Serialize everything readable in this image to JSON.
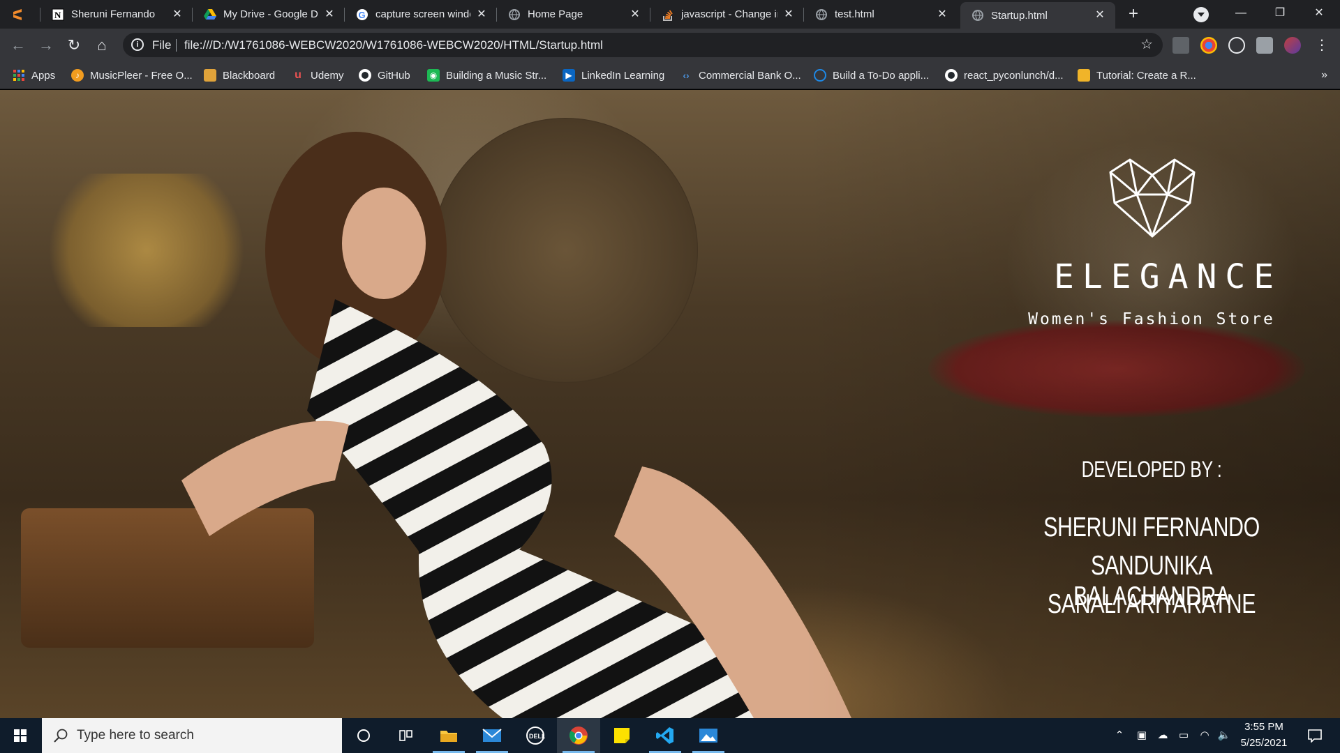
{
  "browser": {
    "tabs": [
      {
        "title": "",
        "icon": "sublime-icon",
        "active": false
      },
      {
        "title": "Sheruni Fernando",
        "icon": "notion-icon",
        "active": false
      },
      {
        "title": "My Drive - Google D",
        "icon": "google-drive-icon",
        "active": false
      },
      {
        "title": "capture screen windo",
        "icon": "google-icon",
        "active": false
      },
      {
        "title": "Home Page",
        "icon": "globe-icon",
        "active": false
      },
      {
        "title": "javascript - Change ir",
        "icon": "stackoverflow-icon",
        "active": false
      },
      {
        "title": "test.html",
        "icon": "globe-icon",
        "active": false
      },
      {
        "title": "Startup.html",
        "icon": "globe-icon",
        "active": true
      }
    ],
    "tab_close_glyph": "✕",
    "new_tab_glyph": "+",
    "window_controls": {
      "minimize": "—",
      "restore": "❐",
      "close": "✕"
    },
    "address": {
      "scheme_label": "File",
      "url": "file:///D:/W1761086-WEBCW2020/W1761086-WEBCW2020/HTML/Startup.html"
    },
    "nav": {
      "back": "←",
      "forward": "→",
      "reload": "↻",
      "home": "⌂"
    },
    "bookmarks": [
      {
        "label": "Apps",
        "icon": "apps-grid-icon",
        "color": "#e8453c"
      },
      {
        "label": "MusicPleer - Free O...",
        "icon": "musicpleer-icon",
        "color": "#f29c1f"
      },
      {
        "label": "Blackboard",
        "icon": "blackboard-icon",
        "color": "#e0a33a"
      },
      {
        "label": "Udemy",
        "icon": "udemy-icon",
        "color": "#ec5252"
      },
      {
        "label": "GitHub",
        "icon": "github-icon",
        "color": "#ffffff"
      },
      {
        "label": "Building a Music Str...",
        "icon": "music-app-icon",
        "color": "#1db954"
      },
      {
        "label": "LinkedIn Learning",
        "icon": "linkedin-learning-icon",
        "color": "#0a66c2"
      },
      {
        "label": "Commercial Bank O...",
        "icon": "bank-icon",
        "color": "#4a90d9"
      },
      {
        "label": "Build a To-Do appli...",
        "icon": "todo-app-icon",
        "color": "#1e88e5"
      },
      {
        "label": "react_pyconlunch/d...",
        "icon": "github-icon",
        "color": "#ffffff"
      },
      {
        "label": "Tutorial: Create a R...",
        "icon": "package-icon",
        "color": "#f0b429"
      }
    ],
    "bookmarks_more": "»"
  },
  "page": {
    "brand_name": "ELEGANCE",
    "tagline": "Women's Fashion Store",
    "developed_by_heading": "DEVELOPED BY :",
    "developers": [
      "SHERUNI FERNANDO",
      "SANDUNIKA BALACHANDRA",
      "SANALI ARIYARATNE"
    ]
  },
  "taskbar": {
    "search_placeholder": "Type here to search",
    "apps": [
      {
        "name": "file-explorer",
        "running": true
      },
      {
        "name": "mail",
        "running": true
      },
      {
        "name": "dell",
        "running": false
      },
      {
        "name": "chrome",
        "running": true
      },
      {
        "name": "sticky-notes",
        "running": false
      },
      {
        "name": "vscode",
        "running": true
      },
      {
        "name": "photos",
        "running": true
      }
    ],
    "clock_time": "3:55 PM",
    "clock_date": "5/25/2021"
  },
  "colors": {
    "tabstrip_bg": "#202124",
    "toolbar_bg": "#35363a",
    "taskbar_bg": "#0f1c2b",
    "hero_text": "#ffffff"
  }
}
